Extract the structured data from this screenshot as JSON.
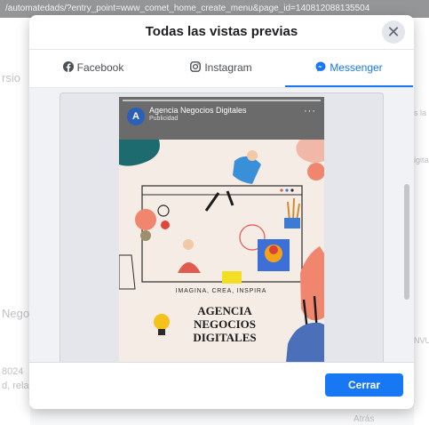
{
  "browser": {
    "url": "/automatedads/?entry_point=www_comet_home_create_menu&page_id=140812088135504"
  },
  "background": {
    "left_fragments": [
      "rsio",
      "Negoc",
      "8024",
      "d, rela"
    ],
    "right_fragments": [
      "s la",
      "igita",
      "NVU"
    ],
    "bottom_button": "Atrás"
  },
  "modal": {
    "title": "Todas las vistas previas",
    "close_glyph": "✕",
    "tabs": [
      {
        "label": "Facebook",
        "icon": "facebook-icon"
      },
      {
        "label": "Instagram",
        "icon": "instagram-icon"
      },
      {
        "label": "Messenger",
        "icon": "messenger-icon",
        "active": true
      }
    ],
    "story": {
      "avatar_letter": "A",
      "page_name": "Agencia Negocios Digitales",
      "subtitle": "Publicidad",
      "menu_glyph": "···",
      "creative": {
        "tagline": "IMAGINA, CREA, INSPIRA",
        "headline_lines": [
          "AGENCIA",
          "NEGOCIOS",
          "DIGITALES"
        ]
      }
    },
    "footer": {
      "close_button": "Cerrar"
    }
  },
  "colors": {
    "accent": "#1877f2",
    "modal_bg": "#ffffff",
    "creative_bg": "#f5ece6"
  }
}
